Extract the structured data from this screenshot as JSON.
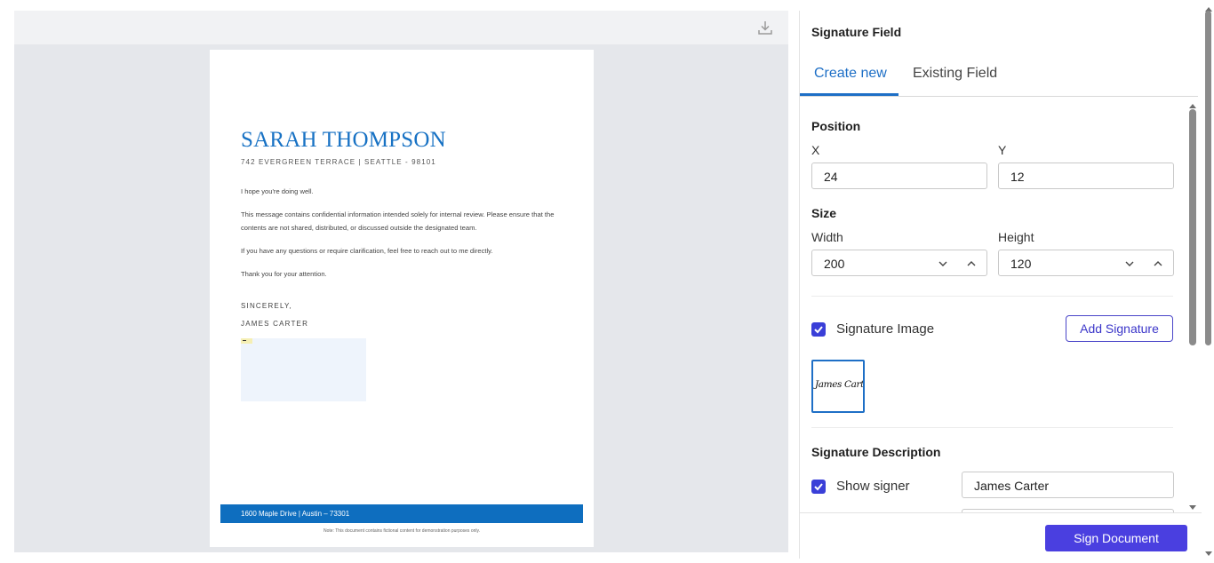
{
  "document": {
    "name": "SARAH THOMPSON",
    "address": "742 EVERGREEN TERRACE | SEATTLE - 98101",
    "body": [
      "I hope you're doing well.",
      "This message contains confidential information intended solely for internal review. Please ensure that the contents are not shared, distributed, or discussed outside the designated team.",
      "If you have any questions or require clarification, feel free to reach out to me directly.",
      "Thank you for your attention."
    ],
    "closing": "SINCERELY,",
    "signer": "JAMES CARTER",
    "footer_address": "1600 Maple Drive | Austin – 73301",
    "footer_note": "Note: This document contains fictional content for demonstration purposes only."
  },
  "toolbar": {
    "download_icon": "download-icon"
  },
  "panel": {
    "title": "Signature Field",
    "tabs": [
      {
        "label": "Create new",
        "active": true
      },
      {
        "label": "Existing Field",
        "active": false
      }
    ],
    "position": {
      "label": "Position",
      "x_label": "X",
      "x_value": "24",
      "y_label": "Y",
      "y_value": "12"
    },
    "size": {
      "label": "Size",
      "width_label": "Width",
      "width_value": "200",
      "height_label": "Height",
      "height_value": "120"
    },
    "signature_image": {
      "label": "Signature Image",
      "checked": true,
      "add_button": "Add Signature",
      "preview_text": "James Carter"
    },
    "description": {
      "label": "Signature Description",
      "show_signer_label": "Show signer",
      "show_signer_checked": true,
      "signer_value": "James Carter"
    },
    "sign_button": "Sign Document"
  },
  "colors": {
    "accent": "#1e6fc6",
    "primary_button": "#4a3fe0",
    "doc_heading": "#1872c4",
    "doc_footer": "#0e6ebf"
  }
}
